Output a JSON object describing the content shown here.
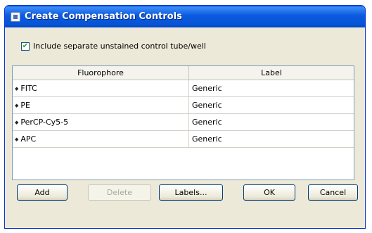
{
  "window": {
    "title": "Create Compensation Controls"
  },
  "checkbox": {
    "label": "Include separate unstained control tube/well",
    "checked": true
  },
  "table": {
    "headers": [
      "Fluorophore",
      "Label"
    ],
    "rows": [
      [
        "FITC",
        "Generic"
      ],
      [
        "PE",
        "Generic"
      ],
      [
        "PerCP-Cy5-5",
        "Generic"
      ],
      [
        "APC",
        "Generic"
      ]
    ]
  },
  "buttons": {
    "add": "Add",
    "delete": "Delete",
    "labels": "Labels...",
    "ok": "OK",
    "cancel": "Cancel"
  }
}
